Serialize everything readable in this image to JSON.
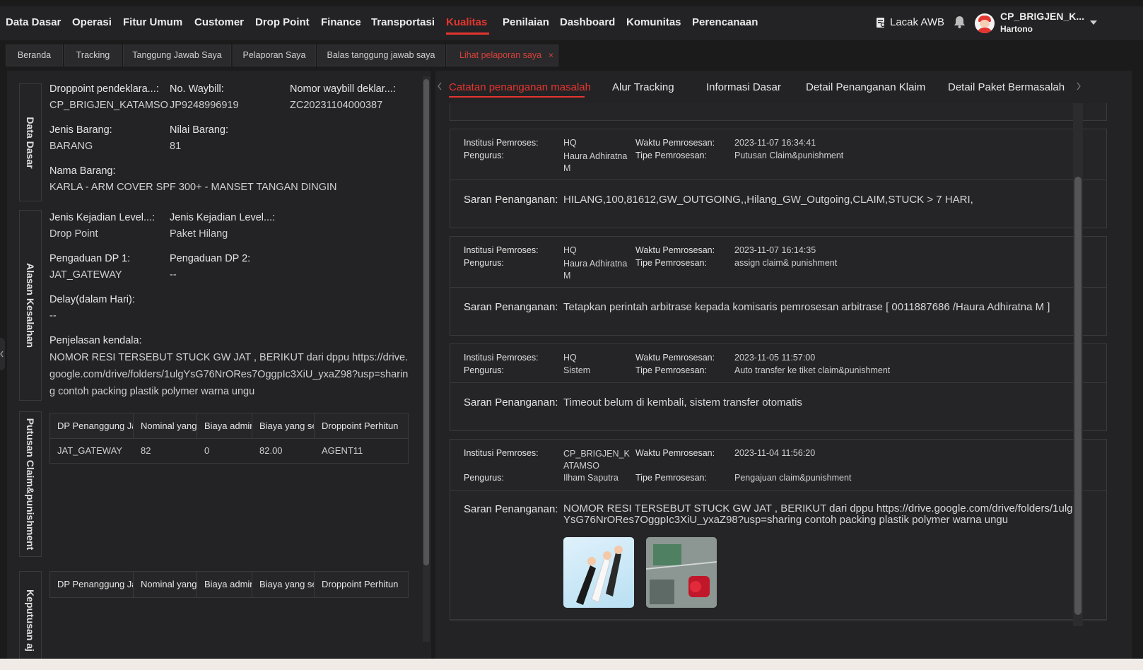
{
  "nav": {
    "items": [
      "Data Dasar",
      "Operasi",
      "Fitur Umum",
      "Customer",
      "Drop Point",
      "Finance",
      "Transportasi",
      "Kualitas",
      "Penilaian",
      "Dashboard",
      "Komunitas",
      "Perencanaan"
    ],
    "active": "Kualitas",
    "track_label": "Lacak AWB",
    "user_name": "CP_BRIGJEN_K...",
    "user_sub": "Hartono"
  },
  "tabs": [
    "Beranda",
    "Tracking",
    "Tanggung Jawab Saya",
    "Pelaporan Saya",
    "Balas tanggung jawab saya",
    "Lihat pelaporan saya"
  ],
  "left": {
    "sections": {
      "data_dasar": "Data Dasar",
      "alasan": "Alasan Kesalahan",
      "putusan": "Putusan Claim&punishment",
      "keputusan": "Keputusan aj"
    },
    "droppoint_label": "Droppoint pendeklara...:",
    "droppoint_value": "CP_BRIGJEN_KATAMSO",
    "waybill_label": "No. Waybill:",
    "waybill_value": "JP9248996919",
    "decl_label": "Nomor waybill deklar...:",
    "decl_value": "ZC20231104000387",
    "jenis_barang_label": "Jenis Barang:",
    "jenis_barang_value": "BARANG",
    "nilai_label": "Nilai Barang:",
    "nilai_value": "81",
    "nama_label": "Nama Barang:",
    "nama_value": "KARLA - ARM COVER SPF 300+ - MANSET TANGAN DINGIN",
    "level1_label": "Jenis Kejadian Level...:",
    "level1_value": "Drop Point",
    "level2_label": "Jenis Kejadian Level...:",
    "level2_value": "Paket Hilang",
    "dp1_label": "Pengaduan DP 1:",
    "dp1_value": "JAT_GATEWAY",
    "dp2_label": "Pengaduan DP 2:",
    "dp2_value": "--",
    "delay_label": "Delay(dalam Hari):",
    "delay_value": "--",
    "penjelasan_label": "Penjelasan kendala:",
    "penjelasan_value": "NOMOR RESI TERSEBUT STUCK GW JAT , BERIKUT dari dppu https://drive.google.com/drive/folders/1ulgYsG76NrORes7OggpIc3XiU_yxaZ98?usp=sharing contoh packing plastik polymer warna ungu",
    "table_headers": [
      "DP Penanggung Jav",
      "Nominal yang",
      "Biaya admin",
      "Biaya yang sel",
      "Droppoint Perhitun"
    ],
    "table_row": [
      "JAT_GATEWAY",
      "82",
      "0",
      "82.00",
      "AGENT11"
    ]
  },
  "right": {
    "tabs": [
      "Catatan penanganan masalah",
      "Alur Tracking",
      "Informasi Dasar",
      "Detail Penanganan Klaim",
      "Detail Paket Bermasalah"
    ],
    "labels": {
      "institusi": "Institusi Pemroses:",
      "pengurus": "Pengurus:",
      "waktu": "Waktu Pemrosesan:",
      "tipe": "Tipe Pemrosesan:",
      "saran": "Saran Penanganan:"
    },
    "records": [
      {
        "institusi": "HQ",
        "pengurus": "Haura Adhiratna M",
        "waktu": "2023-11-07 16:34:41",
        "tipe": "Putusan Claim&punishment",
        "saran": "HILANG,100,81612,GW_OUTGOING,,Hilang_GW_Outgoing,CLAIM,STUCK > 7 HARI,"
      },
      {
        "institusi": "HQ",
        "pengurus": "Haura Adhiratna M",
        "waktu": "2023-11-07 16:14:35",
        "tipe": "assign claim& punishment",
        "saran": "Tetapkan perintah arbitrase kepada komisaris pemrosesan arbitrase [ 0011887686 /Haura Adhiratna M ]"
      },
      {
        "institusi": "HQ",
        "pengurus": "Sistem",
        "waktu": "2023-11-05 11:57:00",
        "tipe": "Auto transfer ke tiket claim&punishment",
        "saran": "Timeout belum di kembali, sistem transfer otomatis"
      },
      {
        "institusi": "CP_BRIGJEN_KATAMSO",
        "pengurus": "Ilham Saputra",
        "waktu": "2023-11-04 11:56:20",
        "tipe": "Pengajuan claim&punishment",
        "saran": "NOMOR RESI TERSEBUT STUCK GW JAT , BERIKUT dari dppu https://drive.google.com/drive/folders/1ulgYsG76NrORes7OggpIc3XiU_yxaZ98?usp=sharing contoh packing plastik polymer warna ungu"
      }
    ]
  },
  "colors": {
    "accent": "#e5352f",
    "bg": "#1b1b1c",
    "panel": "#232325"
  },
  "icons": [
    "awb-icon",
    "bell-icon",
    "avatar",
    "chevron-down-icon",
    "chevron-left-icon",
    "chevron-right-icon",
    "close-icon"
  ]
}
